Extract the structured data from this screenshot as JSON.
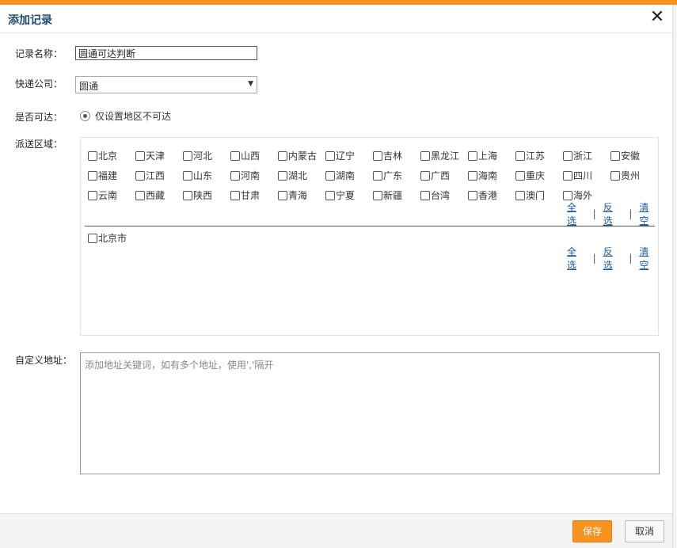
{
  "dialog": {
    "title": "添加记录",
    "close_glyph": "✕"
  },
  "form": {
    "name_label": "记录名称：",
    "name_value": "圆通可达判断",
    "courier_label": "快递公司：",
    "courier_value": "圆通",
    "reachable_label": "是否可达：",
    "reachable_option": "仅设置地区不可达",
    "region_label": "派送区域：",
    "custom_label": "自定义地址：",
    "custom_placeholder": "添加地址关键词，如有多个地址，使用','隔开"
  },
  "provinces": [
    [
      "北京",
      "天津",
      "河北",
      "山西",
      "内蒙古",
      "辽宁",
      "吉林",
      "黑龙江",
      "上海",
      "江苏",
      "浙江",
      "安徽"
    ],
    [
      "福建",
      "江西",
      "山东",
      "河南",
      "湖北",
      "湖南",
      "广东",
      "广西",
      "海南",
      "重庆",
      "四川",
      "贵州"
    ],
    [
      "云南",
      "西藏",
      "陕西",
      "甘肃",
      "青海",
      "宁夏",
      "新疆",
      "台湾",
      "香港",
      "澳门",
      "海外"
    ]
  ],
  "cities": [
    "北京市"
  ],
  "region_actions": {
    "select_all": "全选",
    "invert": "反选",
    "clear": "清空",
    "separator": "|"
  },
  "footer": {
    "save": "保存",
    "cancel": "取消"
  },
  "colors": {
    "accent": "#f7931e",
    "link": "#1a5aa8"
  }
}
